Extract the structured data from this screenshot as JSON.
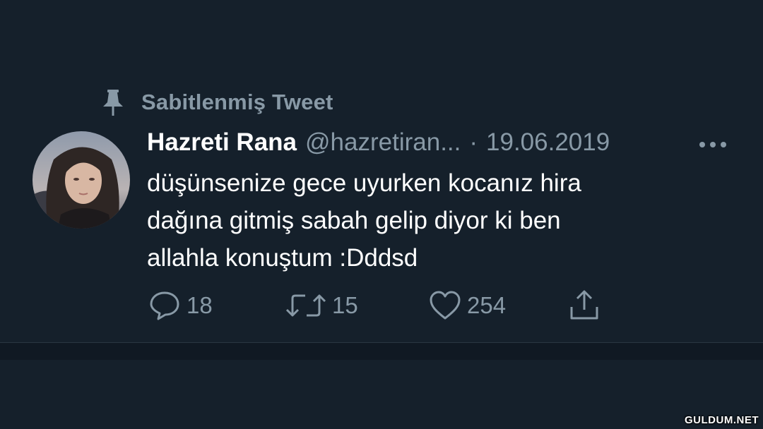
{
  "pinned": {
    "label": "Sabitlenmiş Tweet",
    "icon": "pin-icon"
  },
  "tweet": {
    "display_name": "Hazreti Rana",
    "handle": "@hazretiran...",
    "separator": "·",
    "date": "19.06.2019",
    "body_lines": [
      "düşünsenize gece uyurken kocanız hira",
      "dağına gitmiş sabah gelip diyor ki ben",
      "allahla konuştum :Dddsd"
    ],
    "actions": {
      "reply": {
        "icon": "reply-icon",
        "count": "18"
      },
      "retweet": {
        "icon": "retweet-icon",
        "count": "15"
      },
      "like": {
        "icon": "heart-icon",
        "count": "254"
      },
      "share": {
        "icon": "share-icon"
      }
    },
    "more_icon": "more-icon"
  },
  "watermark": "GULDUM.NET",
  "colors": {
    "background": "#15202b",
    "primary_text": "#ffffff",
    "secondary_text": "#8899a6",
    "divider": "#2a3642"
  }
}
